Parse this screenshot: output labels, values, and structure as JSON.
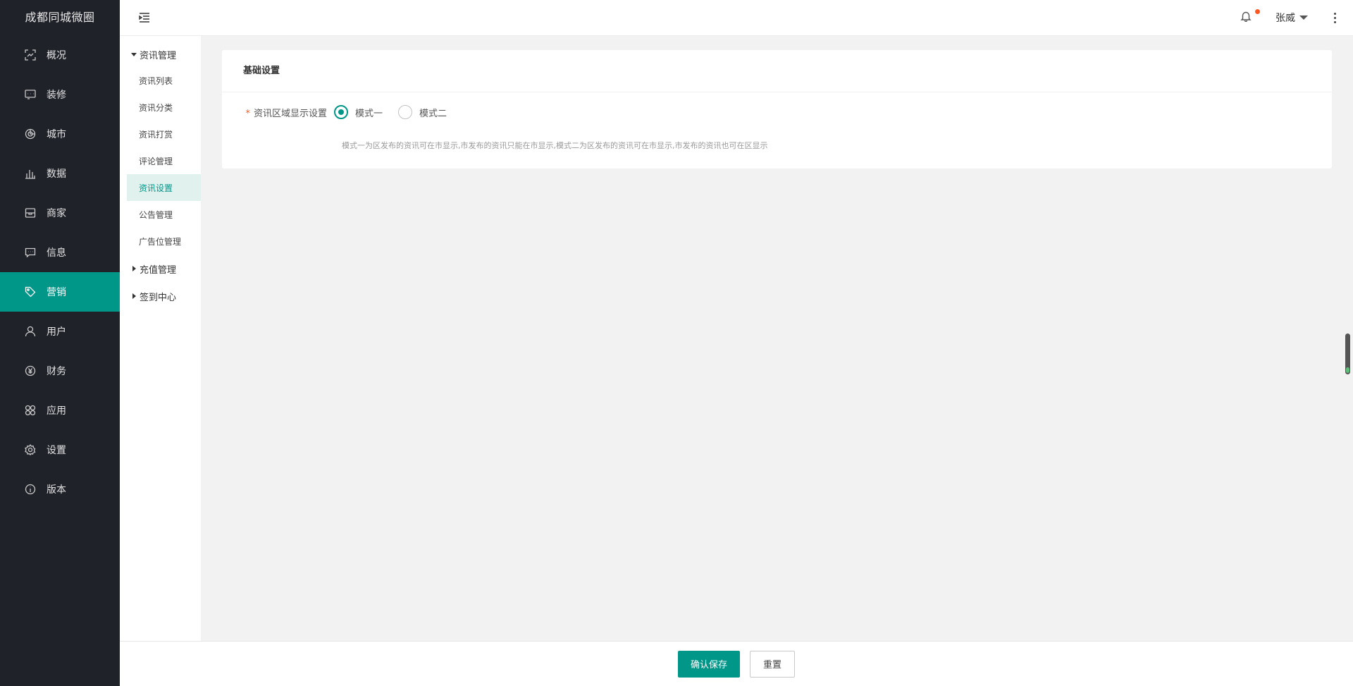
{
  "brand": "成都同城微圈",
  "sidebar": {
    "items": [
      {
        "label": "概况",
        "icon": "overview-icon"
      },
      {
        "label": "装修",
        "icon": "decorate-icon"
      },
      {
        "label": "城市",
        "icon": "city-icon"
      },
      {
        "label": "数据",
        "icon": "chart-icon"
      },
      {
        "label": "商家",
        "icon": "shop-icon"
      },
      {
        "label": "信息",
        "icon": "message-icon"
      },
      {
        "label": "营销",
        "icon": "tag-icon"
      },
      {
        "label": "用户",
        "icon": "user-icon"
      },
      {
        "label": "财务",
        "icon": "yen-icon"
      },
      {
        "label": "应用",
        "icon": "apps-icon"
      },
      {
        "label": "设置",
        "icon": "gear-icon"
      },
      {
        "label": "版本",
        "icon": "info-icon"
      }
    ],
    "active": "营销"
  },
  "header": {
    "user_name": "张威"
  },
  "subnav": {
    "group1": "资讯管理",
    "items": [
      "资讯列表",
      "资讯分类",
      "资讯打赏",
      "评论管理",
      "资讯设置",
      "公告管理",
      "广告位管理"
    ],
    "active": "资讯设置",
    "group2": "充值管理",
    "group3": "签到中心"
  },
  "card": {
    "title": "基础设置",
    "field_label": "资讯区域显示设置",
    "required_mark": "*",
    "options": [
      "模式一",
      "模式二"
    ],
    "selected": "模式一",
    "tip": "模式一为区发布的资讯可在市显示,市发布的资讯只能在市显示,模式二为区发布的资讯可在市显示,市发布的资讯也可在区显示"
  },
  "footer": {
    "save_label": "确认保存",
    "reset_label": "重置"
  },
  "colors": {
    "accent": "#009688",
    "sidebar_bg": "#20222a",
    "badge": "#ff5722"
  }
}
